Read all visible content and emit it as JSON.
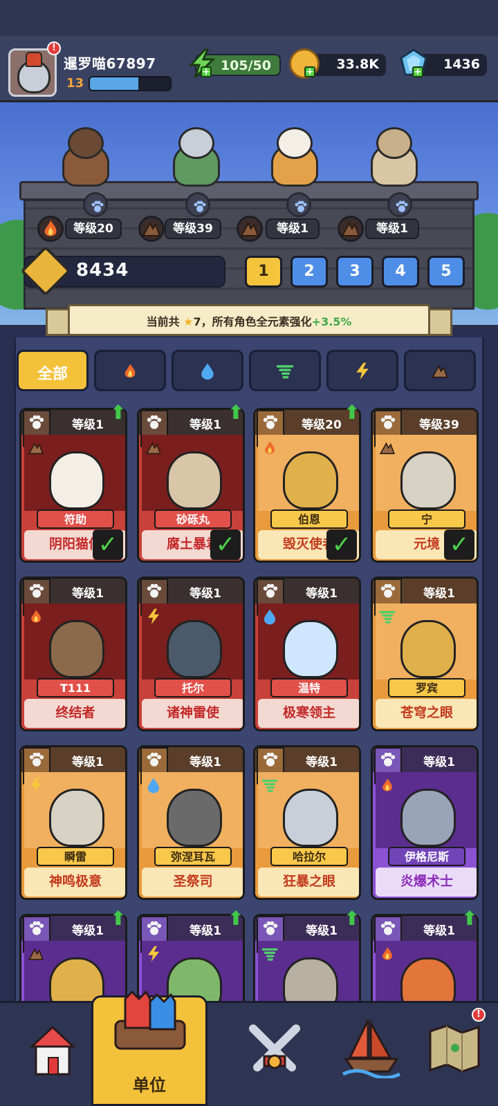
{
  "player": {
    "name": "暹罗喵67897",
    "level": "13",
    "xp_fraction": 0.6,
    "badge": "!"
  },
  "resources": {
    "energy": "105/50",
    "coins": "33.8K",
    "gems": "1436"
  },
  "lineup": [
    {
      "level_label": "等级20",
      "element": "fire"
    },
    {
      "level_label": "等级39",
      "element": "earth"
    },
    {
      "level_label": "等级1",
      "element": "earth"
    },
    {
      "level_label": "等级1",
      "element": "earth"
    }
  ],
  "power": "8434",
  "teams": [
    "1",
    "2",
    "3",
    "4",
    "5"
  ],
  "active_team": "1",
  "banner": {
    "prefix": "当前共",
    "stars": "7",
    "suffix": "，所有角色全元素强化",
    "bonus": "+3.5%"
  },
  "filters": {
    "all_label": "全部",
    "icons": [
      "fire-icon",
      "water-icon",
      "wind-icon",
      "lightning-icon",
      "earth-icon"
    ]
  },
  "cards": [
    {
      "level": "等级1",
      "name": "符助",
      "title": "阴阳猫仙",
      "color": "red",
      "element": "earth",
      "selected": true,
      "upgrade": true
    },
    {
      "level": "等级1",
      "name": "砂砾丸",
      "title": "腐土暴君",
      "color": "red",
      "element": "earth",
      "selected": true,
      "upgrade": true
    },
    {
      "level": "等级20",
      "name": "伯恩",
      "title": "毁灭使者",
      "color": "orange",
      "element": "fire",
      "selected": true,
      "upgrade": true
    },
    {
      "level": "等级39",
      "name": "宁",
      "title": "元境",
      "color": "orange",
      "element": "earth",
      "selected": true,
      "upgrade": false
    },
    {
      "level": "等级1",
      "name": "T111",
      "title": "终结者",
      "color": "red",
      "element": "fire",
      "selected": false,
      "upgrade": false
    },
    {
      "level": "等级1",
      "name": "托尔",
      "title": "诸神雷使",
      "color": "red",
      "element": "lightning",
      "selected": false,
      "upgrade": false
    },
    {
      "level": "等级1",
      "name": "温特",
      "title": "极寒领主",
      "color": "red",
      "element": "water",
      "selected": false,
      "upgrade": false
    },
    {
      "level": "等级1",
      "name": "罗宾",
      "title": "苍穹之眼",
      "color": "orange",
      "element": "wind",
      "selected": false,
      "upgrade": false
    },
    {
      "level": "等级1",
      "name": "瞬雷",
      "title": "神鸣极意",
      "color": "orange",
      "element": "lightning",
      "selected": false,
      "upgrade": false
    },
    {
      "level": "等级1",
      "name": "弥涅耳瓦",
      "title": "圣祭司",
      "color": "orange",
      "element": "water",
      "selected": false,
      "upgrade": false
    },
    {
      "level": "等级1",
      "name": "哈拉尔",
      "title": "狂暴之眼",
      "color": "orange",
      "element": "wind",
      "selected": false,
      "upgrade": false
    },
    {
      "level": "等级1",
      "name": "伊格尼斯",
      "title": "炎爆术士",
      "color": "purple",
      "element": "fire",
      "selected": false,
      "upgrade": false
    },
    {
      "level": "等级1",
      "name": "",
      "title": "",
      "color": "purple",
      "element": "earth",
      "selected": false,
      "upgrade": true
    },
    {
      "level": "等级1",
      "name": "",
      "title": "",
      "color": "purple",
      "element": "lightning",
      "selected": false,
      "upgrade": true
    },
    {
      "level": "等级1",
      "name": "",
      "title": "",
      "color": "purple",
      "element": "wind",
      "selected": false,
      "upgrade": true
    },
    {
      "level": "等级1",
      "name": "",
      "title": "",
      "color": "purple",
      "element": "fire",
      "selected": false,
      "upgrade": true
    }
  ],
  "nav": {
    "units_label": "单位",
    "badge": "!"
  }
}
